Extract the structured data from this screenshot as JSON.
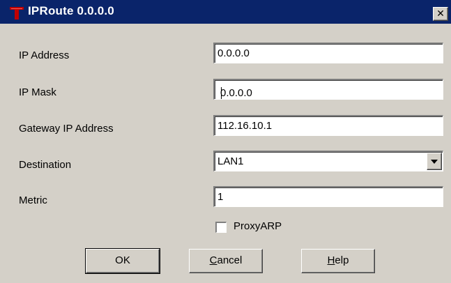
{
  "window": {
    "title": "IPRoute 0.0.0.0",
    "close_glyph": "✕",
    "icon": "red-t-icon",
    "title_bar_color": "#0a246a",
    "icon_color": "#c00000"
  },
  "form": {
    "ip_address": {
      "label": "IP Address",
      "value": "0.0.0.0"
    },
    "ip_mask": {
      "label": "IP Mask",
      "value": "0.0.0.0"
    },
    "gateway": {
      "label": "Gateway IP Address",
      "value": "112.16.10.1"
    },
    "destination": {
      "label": "Destination",
      "selected": "LAN1"
    },
    "metric": {
      "label": "Metric",
      "value": "1"
    },
    "proxy_arp": {
      "label": "ProxyARP",
      "checked": false
    }
  },
  "buttons": {
    "ok": "OK",
    "cancel_first": "C",
    "cancel_rest": "ancel",
    "help_first": "H",
    "help_rest": "elp"
  }
}
